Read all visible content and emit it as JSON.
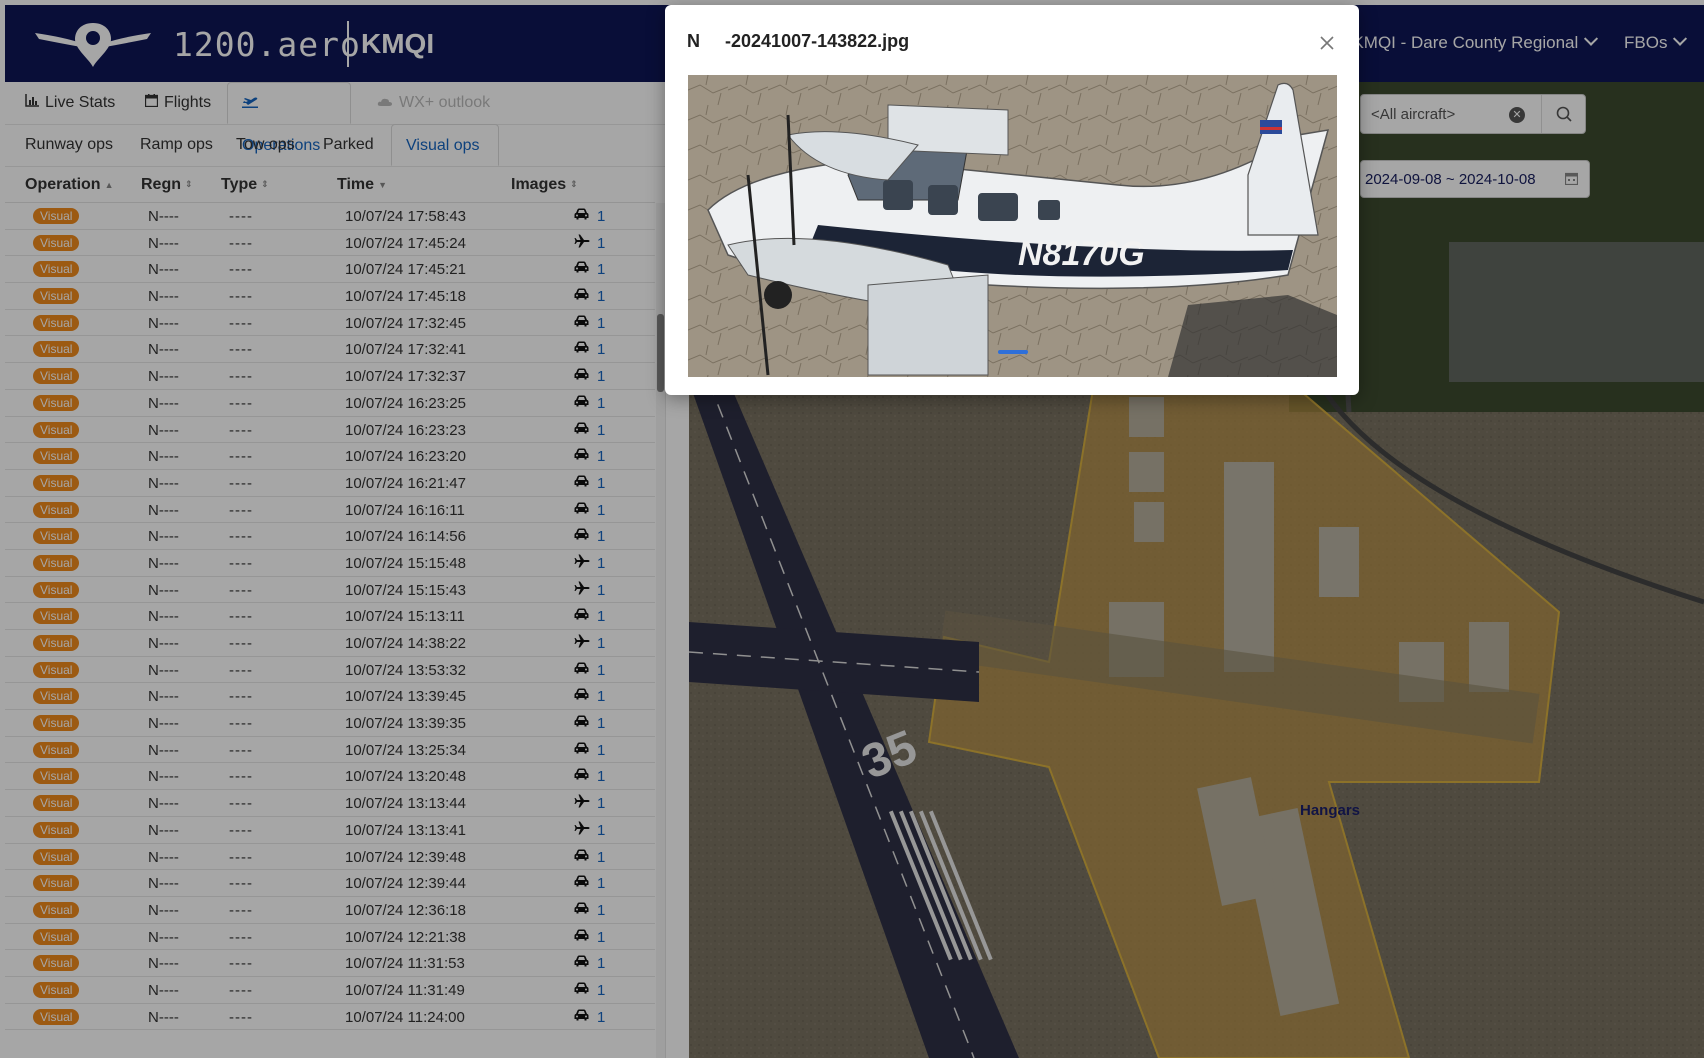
{
  "header": {
    "logo_text": "1200.aero",
    "airport_code": "KMQI",
    "airport_menu": "/ KMQI - Dare County Regional",
    "fbo_menu": "FBOs"
  },
  "tabs_primary": [
    {
      "label": "Live Stats",
      "icon": "bar-chart-icon"
    },
    {
      "label": "Flights",
      "icon": "calendar-icon"
    },
    {
      "label": "Operations",
      "icon": "takeoff-icon"
    },
    {
      "label": "WX+ outlook",
      "icon": "cloud-icon"
    }
  ],
  "tabs_secondary": [
    "Runway ops",
    "Ramp ops",
    "Tow ops",
    "Parked",
    "Visual ops"
  ],
  "table": {
    "headers": [
      "Operation",
      "Regn",
      "Type",
      "Time",
      "Images"
    ],
    "rows": [
      {
        "op": "Visual",
        "regn": "N----",
        "type": "----",
        "time": "10/07/24 17:58:43",
        "icon": "car",
        "count": "1"
      },
      {
        "op": "Visual",
        "regn": "N----",
        "type": "----",
        "time": "10/07/24 17:45:24",
        "icon": "plane",
        "count": "1"
      },
      {
        "op": "Visual",
        "regn": "N----",
        "type": "----",
        "time": "10/07/24 17:45:21",
        "icon": "car",
        "count": "1"
      },
      {
        "op": "Visual",
        "regn": "N----",
        "type": "----",
        "time": "10/07/24 17:45:18",
        "icon": "car",
        "count": "1"
      },
      {
        "op": "Visual",
        "regn": "N----",
        "type": "----",
        "time": "10/07/24 17:32:45",
        "icon": "car",
        "count": "1"
      },
      {
        "op": "Visual",
        "regn": "N----",
        "type": "----",
        "time": "10/07/24 17:32:41",
        "icon": "car",
        "count": "1"
      },
      {
        "op": "Visual",
        "regn": "N----",
        "type": "----",
        "time": "10/07/24 17:32:37",
        "icon": "car",
        "count": "1"
      },
      {
        "op": "Visual",
        "regn": "N----",
        "type": "----",
        "time": "10/07/24 16:23:25",
        "icon": "car",
        "count": "1"
      },
      {
        "op": "Visual",
        "regn": "N----",
        "type": "----",
        "time": "10/07/24 16:23:23",
        "icon": "car",
        "count": "1"
      },
      {
        "op": "Visual",
        "regn": "N----",
        "type": "----",
        "time": "10/07/24 16:23:20",
        "icon": "car",
        "count": "1"
      },
      {
        "op": "Visual",
        "regn": "N----",
        "type": "----",
        "time": "10/07/24 16:21:47",
        "icon": "car",
        "count": "1"
      },
      {
        "op": "Visual",
        "regn": "N----",
        "type": "----",
        "time": "10/07/24 16:16:11",
        "icon": "car",
        "count": "1"
      },
      {
        "op": "Visual",
        "regn": "N----",
        "type": "----",
        "time": "10/07/24 16:14:56",
        "icon": "car",
        "count": "1"
      },
      {
        "op": "Visual",
        "regn": "N----",
        "type": "----",
        "time": "10/07/24 15:15:48",
        "icon": "plane",
        "count": "1"
      },
      {
        "op": "Visual",
        "regn": "N----",
        "type": "----",
        "time": "10/07/24 15:15:43",
        "icon": "plane",
        "count": "1"
      },
      {
        "op": "Visual",
        "regn": "N----",
        "type": "----",
        "time": "10/07/24 15:13:11",
        "icon": "car",
        "count": "1"
      },
      {
        "op": "Visual",
        "regn": "N----",
        "type": "----",
        "time": "10/07/24 14:38:22",
        "icon": "plane",
        "count": "1"
      },
      {
        "op": "Visual",
        "regn": "N----",
        "type": "----",
        "time": "10/07/24 13:53:32",
        "icon": "car",
        "count": "1"
      },
      {
        "op": "Visual",
        "regn": "N----",
        "type": "----",
        "time": "10/07/24 13:39:45",
        "icon": "car",
        "count": "1"
      },
      {
        "op": "Visual",
        "regn": "N----",
        "type": "----",
        "time": "10/07/24 13:39:35",
        "icon": "car",
        "count": "1"
      },
      {
        "op": "Visual",
        "regn": "N----",
        "type": "----",
        "time": "10/07/24 13:25:34",
        "icon": "car",
        "count": "1"
      },
      {
        "op": "Visual",
        "regn": "N----",
        "type": "----",
        "time": "10/07/24 13:20:48",
        "icon": "car",
        "count": "1"
      },
      {
        "op": "Visual",
        "regn": "N----",
        "type": "----",
        "time": "10/07/24 13:13:44",
        "icon": "plane",
        "count": "1"
      },
      {
        "op": "Visual",
        "regn": "N----",
        "type": "----",
        "time": "10/07/24 13:13:41",
        "icon": "plane",
        "count": "1"
      },
      {
        "op": "Visual",
        "regn": "N----",
        "type": "----",
        "time": "10/07/24 12:39:48",
        "icon": "car",
        "count": "1"
      },
      {
        "op": "Visual",
        "regn": "N----",
        "type": "----",
        "time": "10/07/24 12:39:44",
        "icon": "car",
        "count": "1"
      },
      {
        "op": "Visual",
        "regn": "N----",
        "type": "----",
        "time": "10/07/24 12:36:18",
        "icon": "car",
        "count": "1"
      },
      {
        "op": "Visual",
        "regn": "N----",
        "type": "----",
        "time": "10/07/24 12:21:38",
        "icon": "car",
        "count": "1"
      },
      {
        "op": "Visual",
        "regn": "N----",
        "type": "----",
        "time": "10/07/24 11:31:53",
        "icon": "car",
        "count": "1"
      },
      {
        "op": "Visual",
        "regn": "N----",
        "type": "----",
        "time": "10/07/24 11:31:49",
        "icon": "car",
        "count": "1"
      },
      {
        "op": "Visual",
        "regn": "N----",
        "type": "----",
        "time": "10/07/24 11:24:00",
        "icon": "car",
        "count": "1"
      }
    ]
  },
  "filters": {
    "aircraft_placeholder": "<All aircraft>",
    "date_range": "2024-09-08 ~ 2024-10-08"
  },
  "map": {
    "region_label": "Hangars",
    "runway_number": "35"
  },
  "modal": {
    "title_prefix": "N",
    "title_file": "-20241007-143822.jpg",
    "aircraft_tail": "N8170G"
  },
  "colors": {
    "header_bg": "#0f1657",
    "accent": "#1565c0",
    "badge": "#f08a1c"
  }
}
